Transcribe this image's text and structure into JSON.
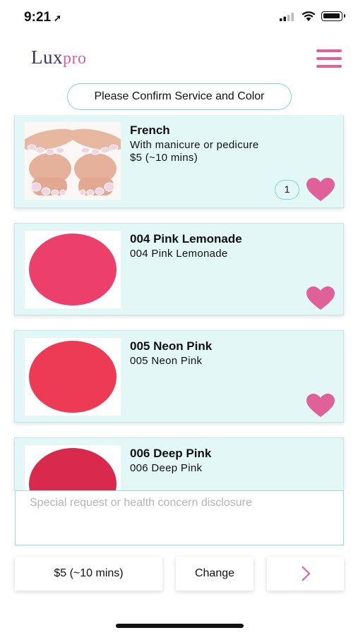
{
  "status_bar": {
    "time": "9:21",
    "location_arrow": "➚"
  },
  "header": {
    "logo_lux": "Lux",
    "logo_pro": "pro",
    "confirm_text": "Please Confirm Service and Color"
  },
  "items": [
    {
      "title": "French",
      "subtitle": "With manicure or pedicure",
      "price": "$5 (~10 mins)",
      "quantity": "1",
      "favorited": true,
      "image": "nails-photo"
    },
    {
      "title": "004 Pink Lemonade",
      "subtitle": "004 Pink Lemonade",
      "favorited": true,
      "swatch_color": "#ec3f6b"
    },
    {
      "title": "005 Neon Pink",
      "subtitle": "005 Neon Pink",
      "favorited": true,
      "swatch_color": "#ee3b55"
    },
    {
      "title": "006 Deep Pink",
      "subtitle": "006 Deep Pink",
      "favorited": true,
      "swatch_color": "#d92a4e"
    }
  ],
  "request": {
    "placeholder": "Special request or health concern disclosure",
    "value": ""
  },
  "bottom_bar": {
    "price_label": "$5 (~10 mins)",
    "change_label": "Change",
    "next_icon": "chevron-right-icon"
  },
  "colors": {
    "accent_pink": "#e0609a",
    "card_bg": "#e3f7f7",
    "teal_border": "#7fd6d8",
    "logo_purple": "#3b2f6e"
  }
}
